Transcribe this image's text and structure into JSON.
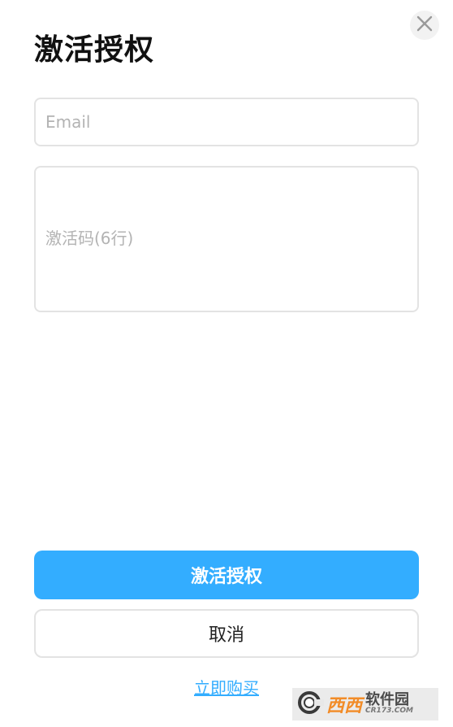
{
  "dialog": {
    "title": "激活授权",
    "close_icon": "close-icon"
  },
  "form": {
    "email_placeholder": "Email",
    "email_value": "",
    "code_placeholder": "激活码(6行)",
    "code_value": ""
  },
  "actions": {
    "activate_label": "激活授权",
    "cancel_label": "取消",
    "buy_label": "立即购买"
  },
  "watermark": {
    "brand_cn": "西西",
    "brand_tag": "软件园",
    "domain": "CR173.COM"
  },
  "colors": {
    "accent": "#33adff",
    "border": "#e3e3e3",
    "placeholder": "#b3b3b3"
  }
}
